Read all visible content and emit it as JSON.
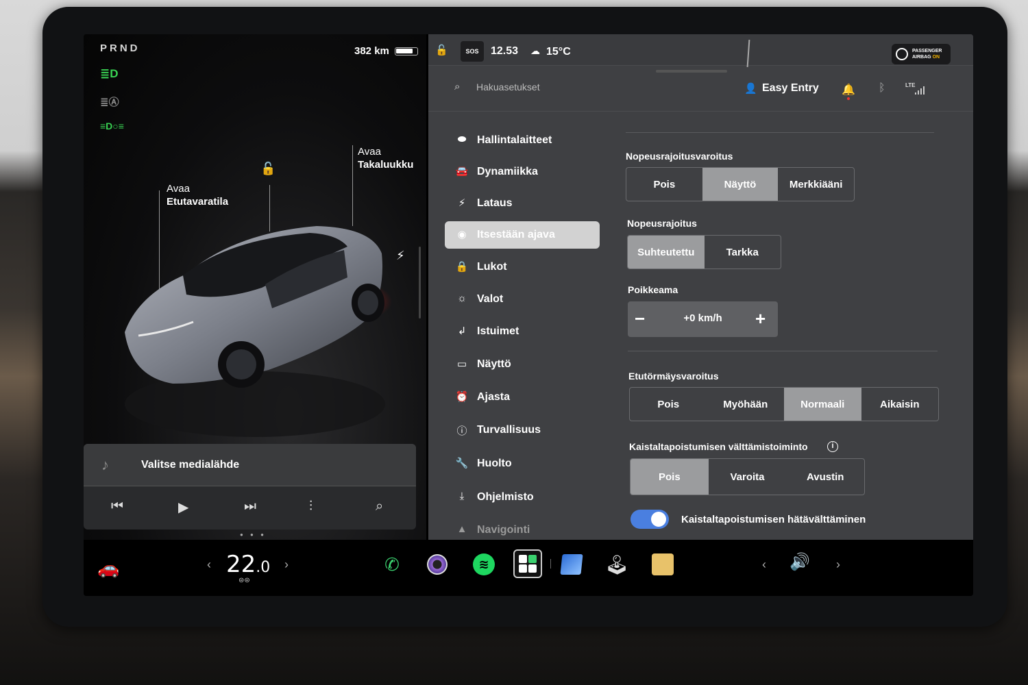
{
  "left_panel": {
    "gear": "PRND",
    "range": "382 km",
    "indicators": [
      {
        "icon": "headlight-icon",
        "glyph": "≣D",
        "color": "#39d353"
      },
      {
        "icon": "auto-headlight-icon",
        "glyph": "≣Ⓐ",
        "color": "#8d8d8d"
      },
      {
        "icon": "parking-light-icon",
        "glyph": "≡D○≡",
        "color": "#39d353"
      }
    ],
    "frunk_callout": {
      "line1": "Avaa",
      "line2": "Etutavaratila"
    },
    "trunk_callout": {
      "line1": "Avaa",
      "line2": "Takaluukku"
    },
    "media": {
      "source_label": "Valitse medialähde",
      "controls": [
        "previous-icon",
        "play-icon",
        "next-icon",
        "equalizer-icon",
        "search-icon"
      ]
    }
  },
  "status_bar": {
    "sos": "SOS",
    "time": "12.53",
    "temperature": "15°C",
    "airbag_line1": "PASSENGER",
    "airbag_line2": "AIRBAG",
    "airbag_state": "ON"
  },
  "header": {
    "search_placeholder": "Hakuasetukset",
    "profile_name": "Easy Entry",
    "network": "LTE"
  },
  "sidebar": {
    "items": [
      {
        "label": "Hallintalaitteet",
        "icon": "toggle-icon",
        "glyph": "⬬"
      },
      {
        "label": "Dynamiikka",
        "icon": "car-icon",
        "glyph": "🚘"
      },
      {
        "label": "Lataus",
        "icon": "lightning-icon",
        "glyph": "⚡"
      },
      {
        "label": "Itsestään ajava",
        "icon": "steering-wheel-icon",
        "glyph": "◉",
        "active": true
      },
      {
        "label": "Lukot",
        "icon": "lock-icon",
        "glyph": "🔒"
      },
      {
        "label": "Valot",
        "icon": "sun-icon",
        "glyph": "☼"
      },
      {
        "label": "Istuimet",
        "icon": "seat-icon",
        "glyph": "↲"
      },
      {
        "label": "Näyttö",
        "icon": "display-icon",
        "glyph": "▭"
      },
      {
        "label": "Ajasta",
        "icon": "alarm-icon",
        "glyph": "⏰"
      },
      {
        "label": "Turvallisuus",
        "icon": "info-circle-icon",
        "glyph": "ⓘ"
      },
      {
        "label": "Huolto",
        "icon": "wrench-icon",
        "glyph": "🔧"
      },
      {
        "label": "Ohjelmisto",
        "icon": "download-icon",
        "glyph": "⤓"
      },
      {
        "label": "Navigointi",
        "icon": "navigation-icon",
        "glyph": "▲"
      }
    ]
  },
  "settings": {
    "speed_limit_warning": {
      "title": "Nopeusrajoitusvaroitus",
      "options": [
        "Pois",
        "Näyttö",
        "Merkkiääni"
      ],
      "selected": "Näyttö"
    },
    "speed_limit": {
      "title": "Nopeusrajoitus",
      "options": [
        "Suhteutettu",
        "Tarkka"
      ],
      "selected": "Suhteutettu"
    },
    "offset": {
      "title": "Poikkeama",
      "value": "+0 km/h",
      "minus": "−",
      "plus": "+"
    },
    "forward_collision_warning": {
      "title": "Etutörmäysvaroitus",
      "options": [
        "Pois",
        "Myöhään",
        "Normaali",
        "Aikaisin"
      ],
      "selected": "Normaali"
    },
    "lane_departure_avoidance": {
      "title": "Kaistaltapoistumisen välttämistoiminto",
      "info": "i",
      "options": [
        "Pois",
        "Varoita",
        "Avustin"
      ],
      "selected": "Pois"
    },
    "emergency_lane_departure": {
      "label": "Kaistaltapoistumisen hätävälttäminen",
      "enabled": true
    }
  },
  "dock": {
    "cabin_temp_whole": "22",
    "cabin_temp_decimal": ".0",
    "apps": [
      "phone-icon",
      "camera-icon",
      "spotify-icon",
      "dashcam-icon",
      "navigation-icon",
      "joystick-icon",
      "toybox-icon"
    ],
    "volume_icon": "volume-icon"
  }
}
